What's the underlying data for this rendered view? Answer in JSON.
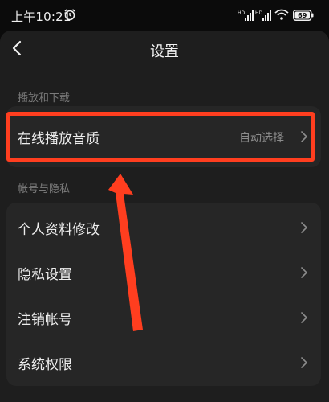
{
  "status_bar": {
    "time": "上午10:21",
    "icons": [
      "alarm-icon",
      "signal-hd-icon",
      "signal-hd-icon",
      "wifi-icon",
      "battery-icon"
    ],
    "battery_level": "69"
  },
  "header": {
    "title": "设置"
  },
  "sections": [
    {
      "label": "播放和下载",
      "items": [
        {
          "label": "在线播放音质",
          "value": "自动选择"
        }
      ]
    },
    {
      "label": "帐号与隐私",
      "items": [
        {
          "label": "个人资料修改"
        },
        {
          "label": "隐私设置"
        },
        {
          "label": "注销帐号"
        },
        {
          "label": "系统权限"
        }
      ]
    }
  ],
  "colors": {
    "annotation": "#ff3e1f",
    "background": "#0b0b0b",
    "sheet": "#1e1e1e",
    "card": "#262626"
  }
}
